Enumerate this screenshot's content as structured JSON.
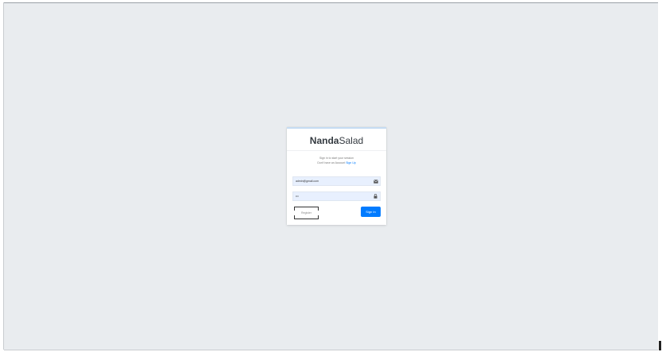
{
  "login": {
    "brand_bold": "Nanda",
    "brand_light": "Salad",
    "message_text": "Sign in to start your session",
    "message_line2": "Don't have an Account",
    "message_link": "Sign Up",
    "email_value": "admin@gmail.com",
    "password_value": "•••",
    "register_label": "Register",
    "signin_label": "Sign In",
    "icons": {
      "email": "envelope-icon",
      "password": "lock-icon"
    },
    "colors": {
      "primary": "#007bff",
      "background": "#e9ecef",
      "autofill": "#e8f0fe"
    }
  }
}
